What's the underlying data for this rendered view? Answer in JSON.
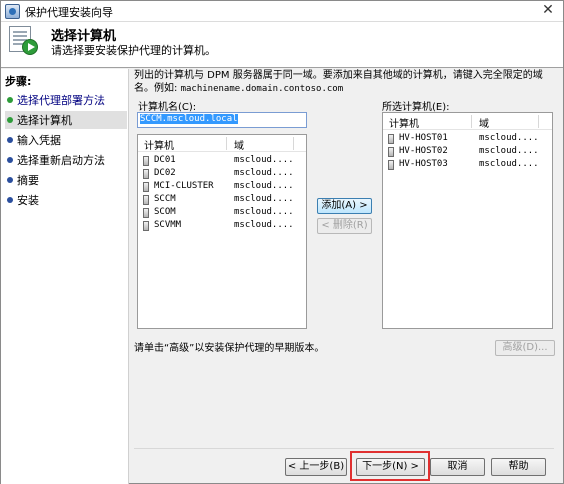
{
  "window": {
    "title": "保护代理安装向导",
    "close_glyph": "✕"
  },
  "header": {
    "title": "选择计算机",
    "subtitle": "请选择要安装保护代理的计算机。",
    "icon": "wizard-play-icon"
  },
  "steps": {
    "title": "步骤:",
    "items": [
      {
        "label": "选择代理部署方法",
        "state": "done"
      },
      {
        "label": "选择计算机",
        "state": "current"
      },
      {
        "label": "输入凭据",
        "state": "pending"
      },
      {
        "label": "选择重新启动方法",
        "state": "pending"
      },
      {
        "label": "摘要",
        "state": "pending"
      },
      {
        "label": "安装",
        "state": "pending"
      }
    ]
  },
  "description": {
    "line1": "列出的计算机与 DPM 服务器属于同一域。要添加来自其他域的计算机，请键入完全限定的域",
    "line2_prefix": "名。例如: ",
    "line2_example": "machinename.domain.contoso.com"
  },
  "computer_name": {
    "label": "计算机名(C):",
    "value": "SCCM.mscloud.local"
  },
  "available_list": {
    "columns": [
      "计算机",
      "域"
    ],
    "rows": [
      {
        "name": "DC01",
        "domain": "mscloud...."
      },
      {
        "name": "DC02",
        "domain": "mscloud...."
      },
      {
        "name": "MCI-CLUSTER",
        "domain": "mscloud...."
      },
      {
        "name": "SCCM",
        "domain": "mscloud...."
      },
      {
        "name": "SCOM",
        "domain": "mscloud...."
      },
      {
        "name": "SCVMM",
        "domain": "mscloud...."
      }
    ]
  },
  "selected_list": {
    "label": "所选计算机(E):",
    "columns": [
      "计算机",
      "域"
    ],
    "rows": [
      {
        "name": "HV-HOST01",
        "domain": "mscloud...."
      },
      {
        "name": "HV-HOST02",
        "domain": "mscloud...."
      },
      {
        "name": "HV-HOST03",
        "domain": "mscloud...."
      }
    ]
  },
  "buttons": {
    "add": "添加(A) >",
    "remove": "< 删除(R)",
    "advanced": "高级(D)...",
    "back": "< 上一步(B)",
    "next": "下一步(N) >",
    "cancel": "取消",
    "help": "帮助"
  },
  "advanced_note": "请单击“高级”以安装保护代理的早期版本。",
  "colors": {
    "highlight": "#e03030",
    "selection": "#3399ff"
  }
}
